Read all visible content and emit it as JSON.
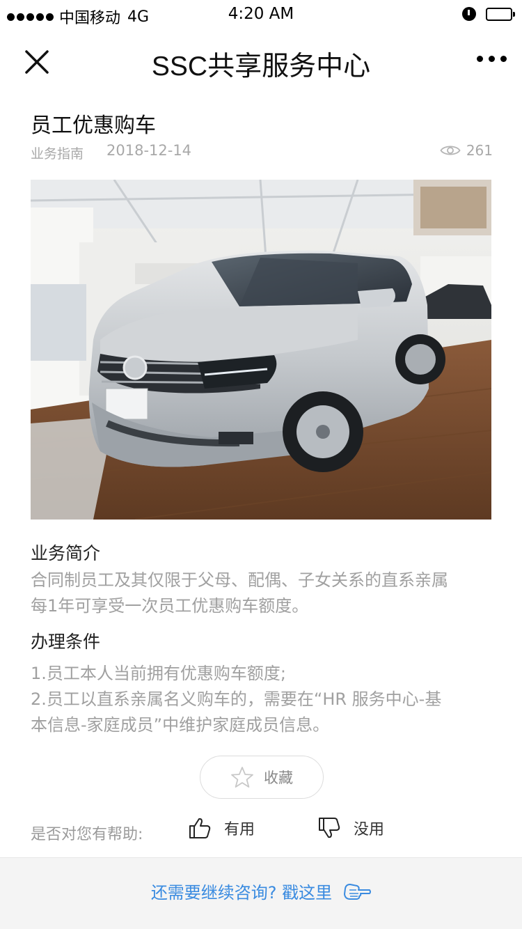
{
  "status_bar": {
    "carrier": "中国移动",
    "network": "4G",
    "time": "4:20 AM"
  },
  "nav": {
    "title": "SSC共享服务中心"
  },
  "article": {
    "title": "员工优惠购车",
    "category": "业务指南",
    "date": "2018-12-14",
    "views": "261"
  },
  "sections": [
    {
      "heading": "业务简介",
      "lines": [
        "合同制员工及其仅限于父母、配偶、子女关系的直系亲属",
        "每1年可享受一次员工优惠购车额度。"
      ]
    },
    {
      "heading": "办理条件",
      "lines": [
        "1.员工本人当前拥有优惠购车额度;",
        "2.员工以直系亲属名义购车的，需要在“HR 服务中心-基",
        "本信息-家庭成员”中维护家庭成员信息。"
      ]
    }
  ],
  "favorite_label": "收藏",
  "feedback": {
    "question": "是否对您有帮助:",
    "useful": "有用",
    "useless": "没用"
  },
  "footer": {
    "consult_text": "还需要继续咨询? 戳这里"
  },
  "colors": {
    "link_blue": "#3a8be0",
    "muted_gray": "#a0a0a0",
    "footer_bg": "#f4f4f4"
  },
  "icons": [
    "close-icon",
    "more-icon",
    "eye-icon",
    "star-icon",
    "thumbs-up-icon",
    "thumbs-down-icon",
    "pointing-hand-icon"
  ]
}
